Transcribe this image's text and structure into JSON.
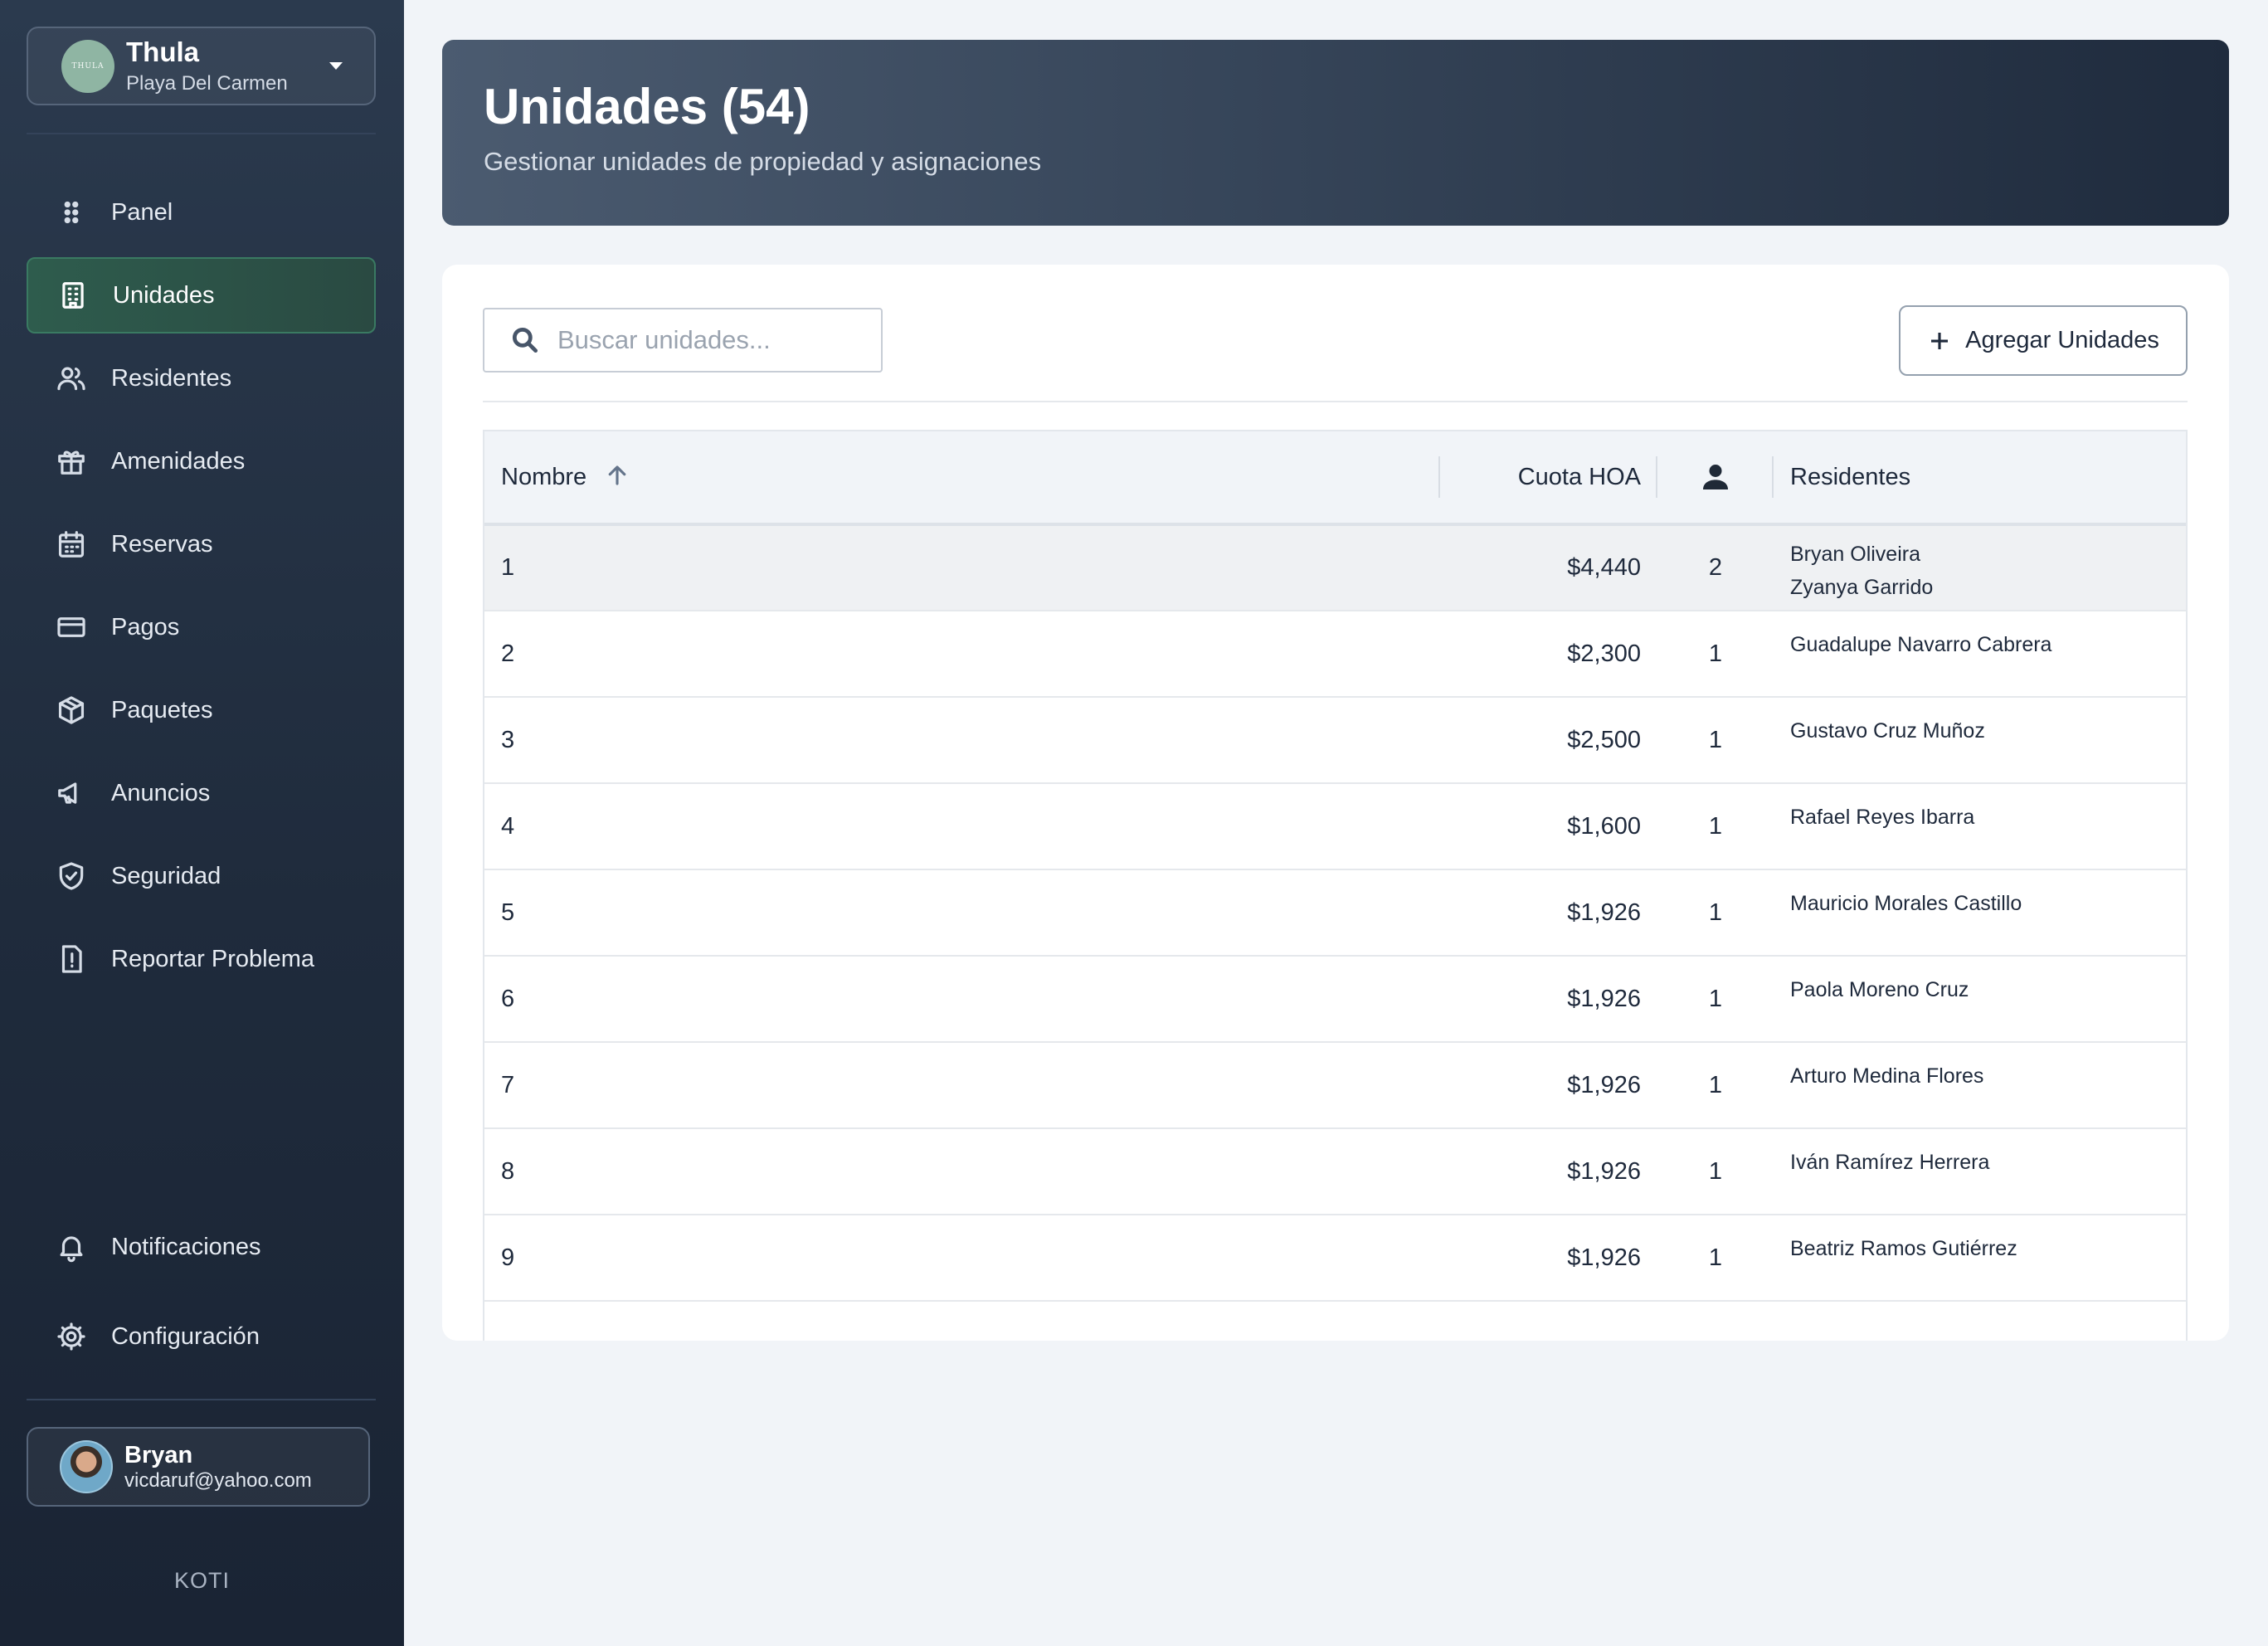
{
  "org": {
    "name": "Thula",
    "location": "Playa Del Carmen",
    "logo_text": "THULA"
  },
  "nav": {
    "items": [
      {
        "label": "Panel",
        "icon": "grid-dots-icon"
      },
      {
        "label": "Unidades",
        "icon": "building-icon",
        "active": true
      },
      {
        "label": "Residentes",
        "icon": "users-icon"
      },
      {
        "label": "Amenidades",
        "icon": "gift-icon"
      },
      {
        "label": "Reservas",
        "icon": "calendar-icon"
      },
      {
        "label": "Pagos",
        "icon": "credit-card-icon"
      },
      {
        "label": "Paquetes",
        "icon": "package-icon"
      },
      {
        "label": "Anuncios",
        "icon": "megaphone-icon"
      },
      {
        "label": "Seguridad",
        "icon": "shield-icon"
      },
      {
        "label": "Reportar Problema",
        "icon": "report-icon"
      }
    ],
    "bottom": [
      {
        "label": "Notificaciones",
        "icon": "bell-icon"
      },
      {
        "label": "Configuración",
        "icon": "gear-icon"
      }
    ]
  },
  "user": {
    "name": "Bryan",
    "email": "vicdaruf@yahoo.com"
  },
  "brand": "KOTI",
  "header": {
    "title": "Unidades (54)",
    "subtitle": "Gestionar unidades de propiedad y asignaciones"
  },
  "search": {
    "placeholder": "Buscar unidades...",
    "value": ""
  },
  "actions": {
    "add_units": "Agregar Unidades"
  },
  "table": {
    "columns": {
      "name": "Nombre",
      "fee": "Cuota HOA",
      "residents": "Residentes"
    },
    "rows": [
      {
        "name": "1",
        "fee": "$4,440",
        "count": "2",
        "residents": [
          "Bryan Oliveira",
          "Zyanya Garrido"
        ]
      },
      {
        "name": "2",
        "fee": "$2,300",
        "count": "1",
        "residents": [
          "Guadalupe Navarro Cabrera"
        ]
      },
      {
        "name": "3",
        "fee": "$2,500",
        "count": "1",
        "residents": [
          "Gustavo Cruz Muñoz"
        ]
      },
      {
        "name": "4",
        "fee": "$1,600",
        "count": "1",
        "residents": [
          "Rafael Reyes Ibarra"
        ]
      },
      {
        "name": "5",
        "fee": "$1,926",
        "count": "1",
        "residents": [
          "Mauricio Morales Castillo"
        ]
      },
      {
        "name": "6",
        "fee": "$1,926",
        "count": "1",
        "residents": [
          "Paola Moreno Cruz"
        ]
      },
      {
        "name": "7",
        "fee": "$1,926",
        "count": "1",
        "residents": [
          "Arturo Medina Flores"
        ]
      },
      {
        "name": "8",
        "fee": "$1,926",
        "count": "1",
        "residents": [
          "Iván Ramírez Herrera"
        ]
      },
      {
        "name": "9",
        "fee": "$1,926",
        "count": "1",
        "residents": [
          "Beatriz Ramos Gutiérrez"
        ]
      }
    ]
  }
}
